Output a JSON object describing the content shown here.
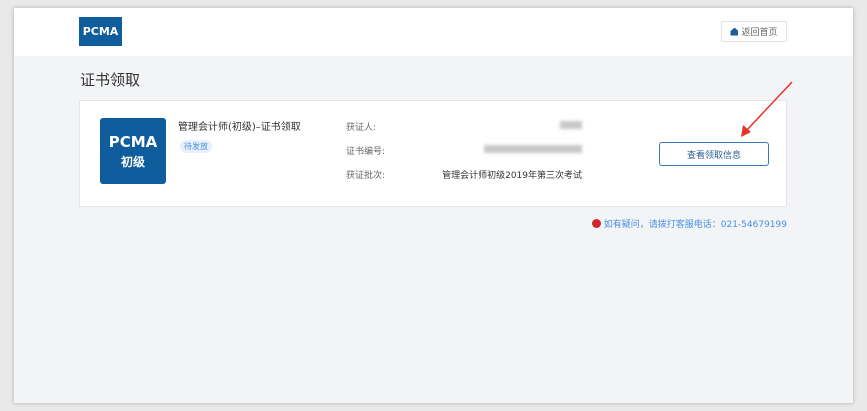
{
  "header": {
    "logo": "PCMA",
    "home_button": "返回首页"
  },
  "page_title": "证书领取",
  "certificate": {
    "badge_line1": "PCMA",
    "badge_line2": "初级",
    "name": "管理会计师(初级)–证书领取",
    "status": "待发放",
    "fields": [
      {
        "label": "获证人:",
        "value": ""
      },
      {
        "label": "证书编号:",
        "value": ""
      },
      {
        "label": "获证批次:",
        "value": "管理会计师初级2019年第三次考试"
      }
    ],
    "view_button": "查看领取信息"
  },
  "help_note": "如有疑问，请拨打客服电话：021-54679199",
  "colors": {
    "brand": "#0f5d9c",
    "link": "#4a8ee6",
    "arrow": "#e8312a"
  }
}
